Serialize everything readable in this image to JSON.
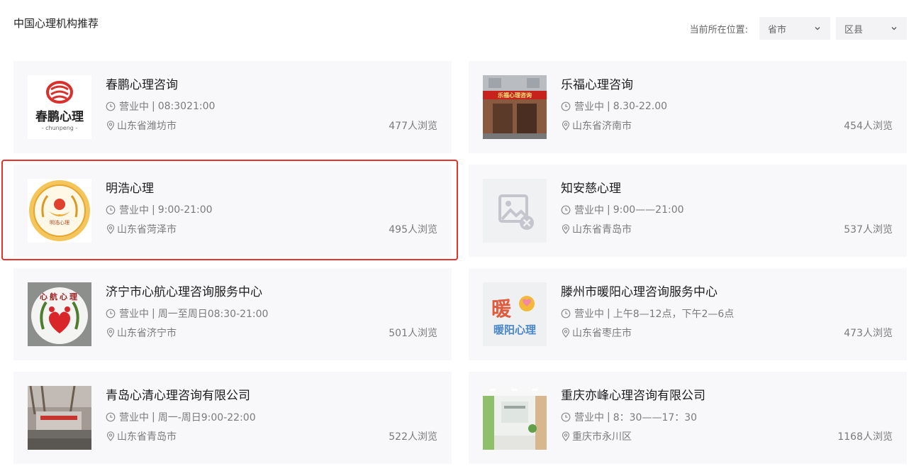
{
  "page": {
    "title": "中国心理机构推荐"
  },
  "location": {
    "label": "当前所在位置:",
    "province": "省市",
    "district": "区县"
  },
  "status_text": "营业中",
  "views_suffix": "人浏览",
  "institutions": [
    {
      "name": "春鹏心理咨询",
      "hours": "08:3021:00",
      "address": "山东省潍坊市",
      "views": "477",
      "thumb": "chunpeng-logo",
      "logo_text": "春鹏心理",
      "logo_sub": "- chunpeng -"
    },
    {
      "name": "乐福心理咨询",
      "hours": "8.30-22.00",
      "address": "山东省济南市",
      "views": "454",
      "thumb": "storefront-photo",
      "logo_text": "乐福心理咨询"
    },
    {
      "name": "明浩心理",
      "hours": "9:00-21:00",
      "address": "山东省菏泽市",
      "views": "495",
      "thumb": "minghao-badge-logo",
      "logo_text": "明浩心理",
      "highlight": true
    },
    {
      "name": "知安慈心理",
      "hours": "9:00——21:00",
      "address": "山东省青岛市",
      "views": "537",
      "thumb": "image-placeholder-icon"
    },
    {
      "name": "济宁市心航心理咨询服务中心",
      "hours": "周一至周日08:30-21:00",
      "address": "山东省济宁市",
      "views": "501",
      "thumb": "xinhang-logo",
      "logo_text": "心航心理"
    },
    {
      "name": "滕州市暖阳心理咨询服务中心",
      "hours": "上午8—12点，下午2—6点",
      "address": "山东省枣庄市",
      "views": "473",
      "thumb": "nuanyang-logo",
      "logo_text": "暖",
      "logo_sub": "暖阳心理"
    },
    {
      "name": "青岛心清心理咨询有限公司",
      "hours": "周一-周日9:00-22:00",
      "address": "山东省青岛市",
      "views": "522",
      "thumb": "building-photo"
    },
    {
      "name": "重庆亦峰心理咨询有限公司",
      "hours": "8：30——17：30",
      "address": "重庆市永川区",
      "views": "1168",
      "thumb": "office-interior-photo"
    }
  ]
}
